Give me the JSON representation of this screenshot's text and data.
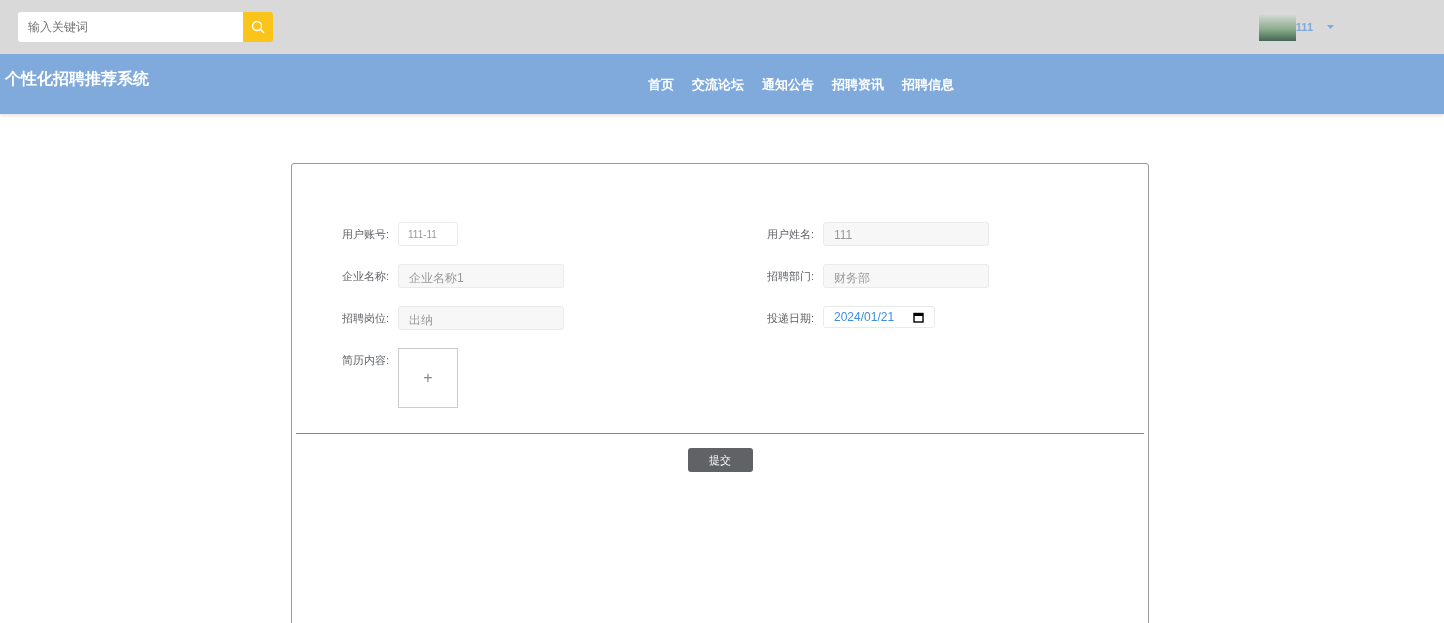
{
  "search": {
    "placeholder": "输入关键词"
  },
  "user": {
    "name": "111"
  },
  "site_title": "个性化招聘推荐系统",
  "nav": [
    {
      "label": "首页"
    },
    {
      "label": "交流论坛"
    },
    {
      "label": "通知公告"
    },
    {
      "label": "招聘资讯"
    },
    {
      "label": "招聘信息"
    }
  ],
  "form": {
    "fields": [
      {
        "label": "用户账号:",
        "kind": "short",
        "value": "111-11"
      },
      {
        "label": "用户姓名:",
        "kind": "text",
        "value": "111"
      },
      {
        "label": "企业名称:",
        "kind": "text",
        "value": "企业名称1"
      },
      {
        "label": "招聘部门:",
        "kind": "text",
        "value": "财务部"
      },
      {
        "label": "招聘岗位:",
        "kind": "text",
        "value": "出纳"
      },
      {
        "label": "投递日期:",
        "kind": "date",
        "value": "2024/01/21"
      },
      {
        "label": "简历内容:",
        "kind": "upload",
        "value": "+"
      }
    ],
    "submit": "提交"
  }
}
